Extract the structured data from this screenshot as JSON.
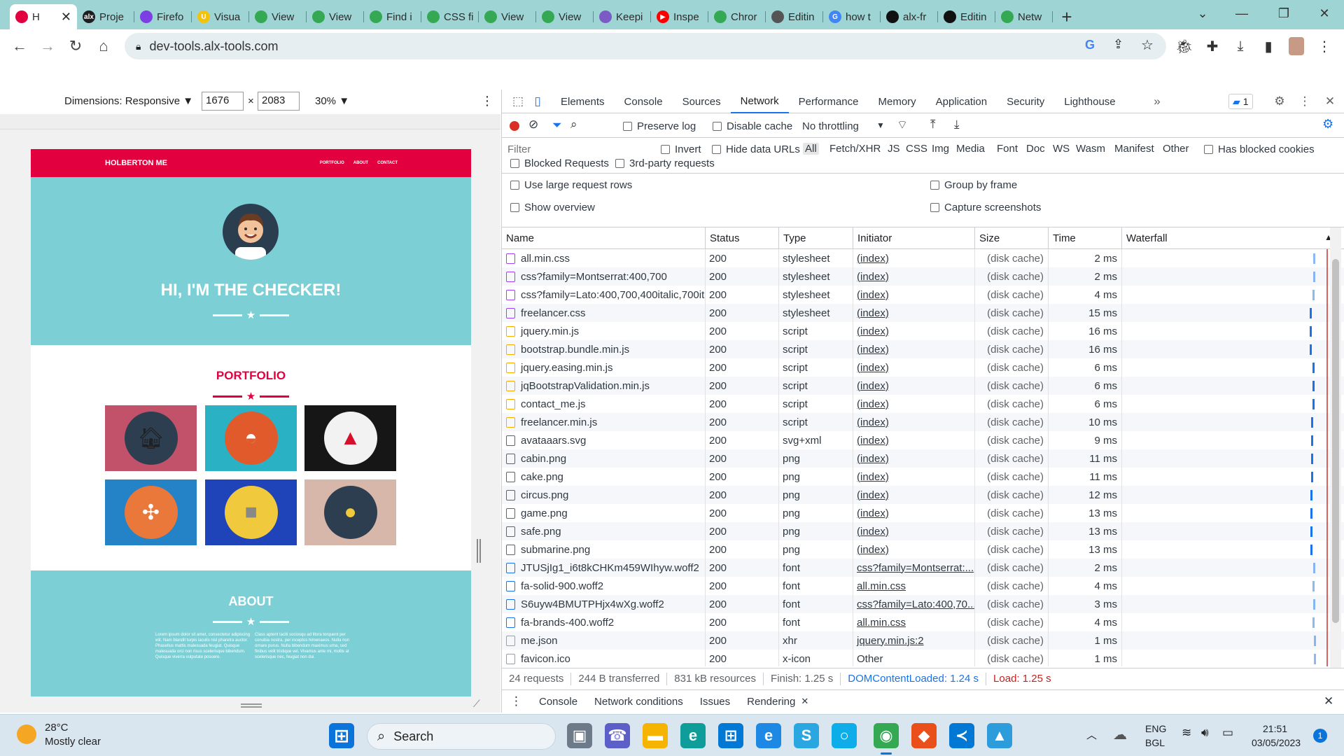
{
  "browser": {
    "tabs": [
      {
        "label": "H",
        "icon_color": "#e2003f",
        "icon_glyph": "",
        "active": true
      },
      {
        "label": "Proje",
        "icon_color": "#1e1e1e",
        "icon_glyph": "alx"
      },
      {
        "label": "Firefo",
        "icon_color": "#7b3fe4",
        "icon_glyph": ""
      },
      {
        "label": "Visua",
        "icon_color": "#f4c20d",
        "icon_glyph": "U"
      },
      {
        "label": "View",
        "icon_color": "#34a853",
        "icon_glyph": ""
      },
      {
        "label": "View",
        "icon_color": "#34a853",
        "icon_glyph": ""
      },
      {
        "label": "Find i",
        "icon_color": "#34a853",
        "icon_glyph": ""
      },
      {
        "label": "CSS fi",
        "icon_color": "#34a853",
        "icon_glyph": ""
      },
      {
        "label": "View",
        "icon_color": "#34a853",
        "icon_glyph": ""
      },
      {
        "label": "View",
        "icon_color": "#34a853",
        "icon_glyph": ""
      },
      {
        "label": "Keepi",
        "icon_color": "#7b5cc7",
        "icon_glyph": ""
      },
      {
        "label": "Inspe",
        "icon_color": "#ff0000",
        "icon_glyph": "▶"
      },
      {
        "label": "Chror",
        "icon_color": "#34a853",
        "icon_glyph": ""
      },
      {
        "label": "Editin",
        "icon_color": "#555555",
        "icon_glyph": ""
      },
      {
        "label": "how t",
        "icon_color": "#4285f4",
        "icon_glyph": "G"
      },
      {
        "label": "alx-fr",
        "icon_color": "#111111",
        "icon_glyph": ""
      },
      {
        "label": "Editin",
        "icon_color": "#111111",
        "icon_glyph": ""
      },
      {
        "label": "Netw",
        "icon_color": "#34a853",
        "icon_glyph": ""
      }
    ],
    "url": "dev-tools.alx-tools.com"
  },
  "device_toolbar": {
    "dimensions_label": "Dimensions: Responsive ▼",
    "width": "1676",
    "times": "×",
    "height": "2083",
    "zoom": "30% ▼"
  },
  "site": {
    "brand": "HOLBERTON ME",
    "nav_links": [
      "PORTFOLIO",
      "ABOUT",
      "CONTACT"
    ],
    "hero_title": "HI, I'M THE CHECKER!",
    "portfolio_title": "PORTFOLIO",
    "about_title": "ABOUT",
    "about_left": "Lorem ipsum dolor sit amet, consectetur adipiscing elit. Nam blandit turpis iaculis nisl pharetra auctor. Phasellus mattis malesuada feugiat. Quisque malesuada orci non risus scelerisque bibendum. Quisque viverra vulputate posuere.",
    "about_right": "Class aptent taciti sociosqu ad litora torquent per conubia nostra, per inceptos himenaeos. Nulla non ornare purus. Nulla bibendum maximus urna, sed finibus velit tristique vel. Vivamus ante mi, mollis at scelerisque nec, feugiat non dui.",
    "colors": {
      "nav": "#e2003f",
      "hero": "#7dcfd6",
      "accent": "#e2003f"
    }
  },
  "devtools": {
    "tabs": [
      "Elements",
      "Console",
      "Sources",
      "Network",
      "Performance",
      "Memory",
      "Application",
      "Security",
      "Lighthouse"
    ],
    "active_tab": "Network",
    "issues_count": "1",
    "preserve_log": "Preserve log",
    "disable_cache": "Disable cache",
    "throttling": "No throttling",
    "filter_placeholder": "Filter",
    "invert": "Invert",
    "hide_data_urls": "Hide data URLs",
    "types": [
      "All",
      "Fetch/XHR",
      "JS",
      "CSS",
      "Img",
      "Media",
      "Font",
      "Doc",
      "WS",
      "Wasm",
      "Manifest",
      "Other"
    ],
    "has_blocked_cookies": "Has blocked cookies",
    "blocked_requests": "Blocked Requests",
    "third_party": "3rd-party requests",
    "large_rows": "Use large request rows",
    "group_by_frame": "Group by frame",
    "show_overview": "Show overview",
    "capture_screenshots": "Capture screenshots",
    "columns": [
      "Name",
      "Status",
      "Type",
      "Initiator",
      "Size",
      "Time",
      "Waterfall"
    ],
    "rows": [
      {
        "name": "all.min.css",
        "status": "200",
        "type": "stylesheet",
        "initiator": "(index)",
        "size": "(disk cache)",
        "time": "2 ms",
        "kind": "css"
      },
      {
        "name": "css?family=Montserrat:400,700",
        "status": "200",
        "type": "stylesheet",
        "initiator": "(index)",
        "size": "(disk cache)",
        "time": "2 ms",
        "kind": "css"
      },
      {
        "name": "css?family=Lato:400,700,400italic,700italic",
        "status": "200",
        "type": "stylesheet",
        "initiator": "(index)",
        "size": "(disk cache)",
        "time": "4 ms",
        "kind": "css"
      },
      {
        "name": "freelancer.css",
        "status": "200",
        "type": "stylesheet",
        "initiator": "(index)",
        "size": "(disk cache)",
        "time": "15 ms",
        "kind": "css"
      },
      {
        "name": "jquery.min.js",
        "status": "200",
        "type": "script",
        "initiator": "(index)",
        "size": "(disk cache)",
        "time": "16 ms",
        "kind": "js"
      },
      {
        "name": "bootstrap.bundle.min.js",
        "status": "200",
        "type": "script",
        "initiator": "(index)",
        "size": "(disk cache)",
        "time": "16 ms",
        "kind": "js"
      },
      {
        "name": "jquery.easing.min.js",
        "status": "200",
        "type": "script",
        "initiator": "(index)",
        "size": "(disk cache)",
        "time": "6 ms",
        "kind": "js"
      },
      {
        "name": "jqBootstrapValidation.min.js",
        "status": "200",
        "type": "script",
        "initiator": "(index)",
        "size": "(disk cache)",
        "time": "6 ms",
        "kind": "js"
      },
      {
        "name": "contact_me.js",
        "status": "200",
        "type": "script",
        "initiator": "(index)",
        "size": "(disk cache)",
        "time": "6 ms",
        "kind": "js"
      },
      {
        "name": "freelancer.min.js",
        "status": "200",
        "type": "script",
        "initiator": "(index)",
        "size": "(disk cache)",
        "time": "10 ms",
        "kind": "js"
      },
      {
        "name": "avataaars.svg",
        "status": "200",
        "type": "svg+xml",
        "initiator": "(index)",
        "size": "(disk cache)",
        "time": "9 ms",
        "kind": "img"
      },
      {
        "name": "cabin.png",
        "status": "200",
        "type": "png",
        "initiator": "(index)",
        "size": "(disk cache)",
        "time": "11 ms",
        "kind": "img"
      },
      {
        "name": "cake.png",
        "status": "200",
        "type": "png",
        "initiator": "(index)",
        "size": "(disk cache)",
        "time": "11 ms",
        "kind": "img"
      },
      {
        "name": "circus.png",
        "status": "200",
        "type": "png",
        "initiator": "(index)",
        "size": "(disk cache)",
        "time": "12 ms",
        "kind": "img"
      },
      {
        "name": "game.png",
        "status": "200",
        "type": "png",
        "initiator": "(index)",
        "size": "(disk cache)",
        "time": "13 ms",
        "kind": "img"
      },
      {
        "name": "safe.png",
        "status": "200",
        "type": "png",
        "initiator": "(index)",
        "size": "(disk cache)",
        "time": "13 ms",
        "kind": "img"
      },
      {
        "name": "submarine.png",
        "status": "200",
        "type": "png",
        "initiator": "(index)",
        "size": "(disk cache)",
        "time": "13 ms",
        "kind": "img"
      },
      {
        "name": "JTUSjIg1_i6t8kCHKm459WIhyw.woff2",
        "status": "200",
        "type": "font",
        "initiator": "css?family=Montserrat:...",
        "size": "(disk cache)",
        "time": "2 ms",
        "kind": "font"
      },
      {
        "name": "fa-solid-900.woff2",
        "status": "200",
        "type": "font",
        "initiator": "all.min.css",
        "size": "(disk cache)",
        "time": "4 ms",
        "kind": "font"
      },
      {
        "name": "S6uyw4BMUTPHjx4wXg.woff2",
        "status": "200",
        "type": "font",
        "initiator": "css?family=Lato:400,70...",
        "size": "(disk cache)",
        "time": "3 ms",
        "kind": "font"
      },
      {
        "name": "fa-brands-400.woff2",
        "status": "200",
        "type": "font",
        "initiator": "all.min.css",
        "size": "(disk cache)",
        "time": "4 ms",
        "kind": "font"
      },
      {
        "name": "me.json",
        "status": "200",
        "type": "xhr",
        "initiator": "jquery.min.js:2",
        "size": "(disk cache)",
        "time": "1 ms",
        "kind": "other"
      },
      {
        "name": "favicon.ico",
        "status": "200",
        "type": "x-icon",
        "initiator": "Other",
        "size": "(disk cache)",
        "time": "1 ms",
        "kind": "other"
      }
    ],
    "status_bar": {
      "requests": "24 requests",
      "transferred": "244 B transferred",
      "resources": "831 kB resources",
      "finish": "Finish: 1.25 s",
      "dcl": "DOMContentLoaded: 1.24 s",
      "load": "Load: 1.25 s"
    },
    "drawer_tabs": [
      "Console",
      "Network conditions",
      "Issues",
      "Rendering"
    ]
  },
  "taskbar": {
    "temperature": "28°C",
    "weather": "Mostly clear",
    "search": "Search",
    "lang1": "ENG",
    "lang2": "BGL",
    "time": "21:51",
    "date": "03/05/2023",
    "notif_count": "1"
  }
}
